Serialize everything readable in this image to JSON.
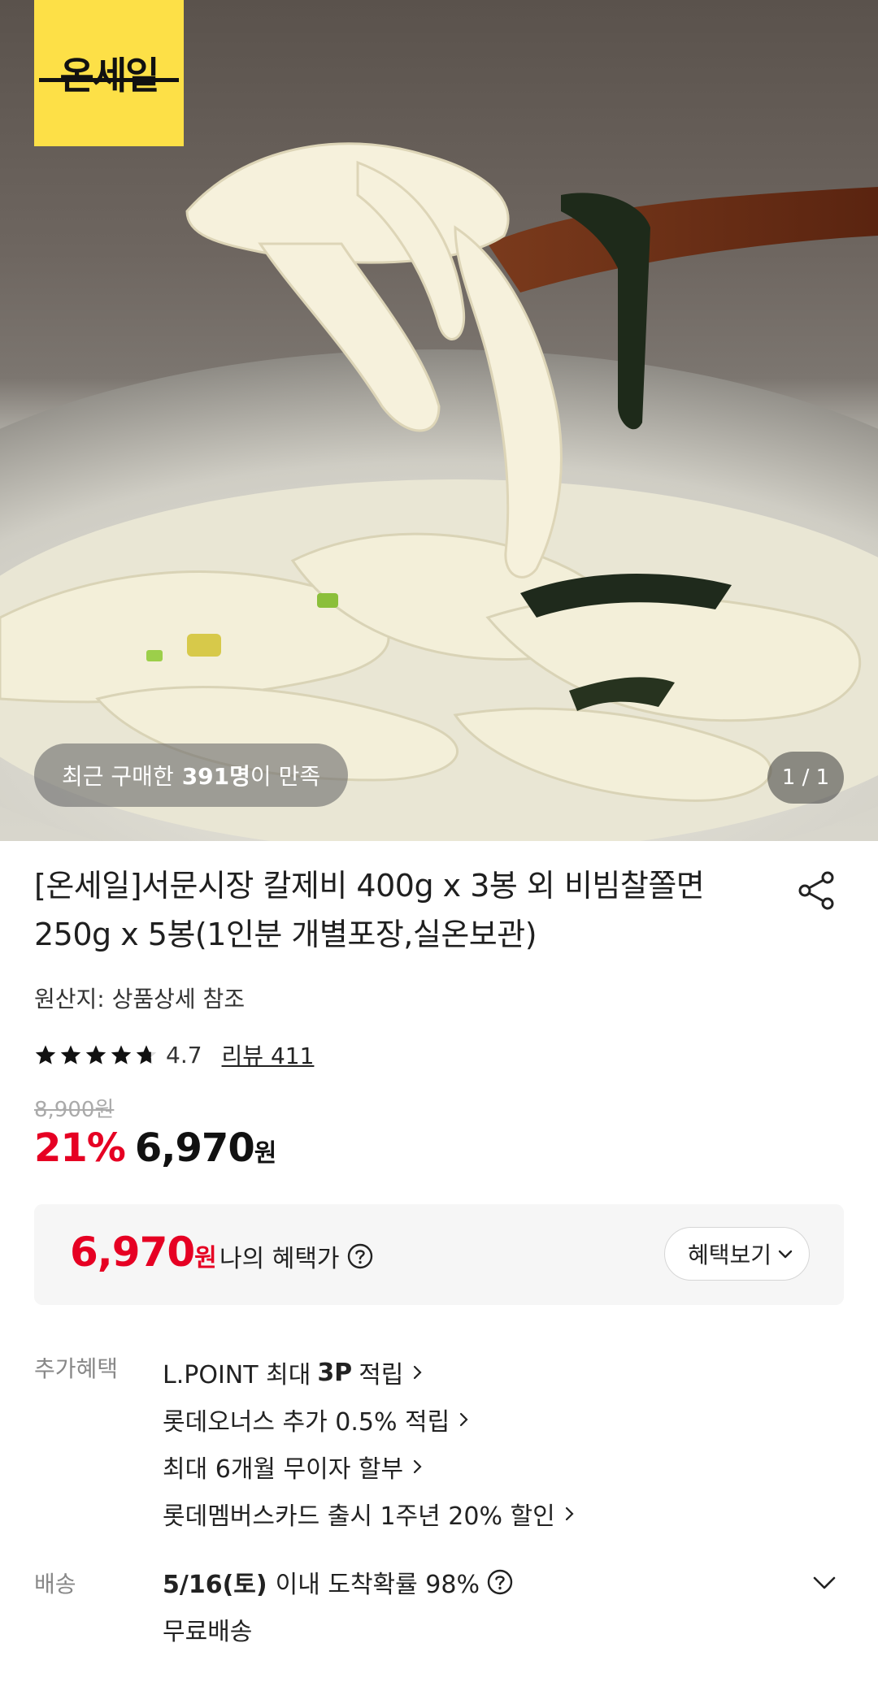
{
  "hero": {
    "brand_logo": "온세일",
    "satisfaction_prefix": "최근 구매한",
    "satisfaction_count": "391명",
    "satisfaction_suffix": "이 만족",
    "page_counter": "1 / 1"
  },
  "product": {
    "title": "[온세일]서문시장 칼제비 400g x 3봉 외 비빔찰쫄면 250g x 5봉(1인분 개별포장,실온보관)",
    "origin": "원산지: 상품상세 참조",
    "rating": "4.7",
    "rating_stars": 4.7,
    "review_link": "리뷰 411",
    "original_price": "8,900원",
    "discount": "21%",
    "price": "6,970",
    "currency": "원"
  },
  "benefit": {
    "price": "6,970",
    "currency": "원",
    "label": "나의 혜택가",
    "button": "혜택보기"
  },
  "additional": {
    "label": "추가혜택",
    "items": [
      {
        "pre": "L.POINT 최대",
        "bold": "3P",
        "post": "적립"
      },
      {
        "pre": "롯데오너스 추가 0.5% 적립",
        "bold": "",
        "post": ""
      },
      {
        "pre": "최대 6개월 무이자 할부",
        "bold": "",
        "post": ""
      },
      {
        "pre": "롯데멤버스카드 출시 1주년 20% 할인",
        "bold": "",
        "post": ""
      }
    ]
  },
  "delivery": {
    "label": "배송",
    "date": "5/16(토)",
    "eta_text": "이내 도착확률 98%",
    "fee": "무료배송"
  },
  "colors": {
    "accent_red": "#e60023",
    "brand_yellow": "#fde047"
  }
}
